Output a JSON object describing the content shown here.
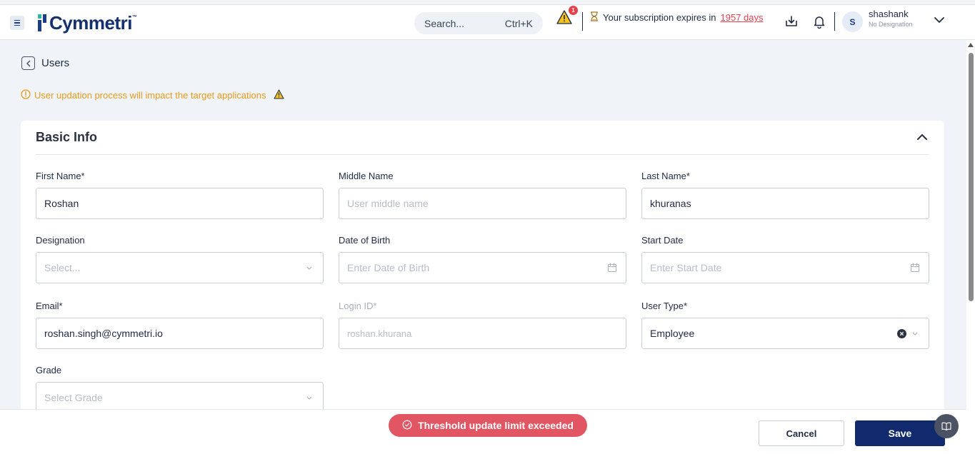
{
  "header": {
    "logo_text": "Cymmetri",
    "logo_tm": "™",
    "search": {
      "placeholder": "Search...",
      "shortcut": "Ctrl+K"
    },
    "alerts_count": "1",
    "subscription": {
      "prefix": "Your subscription expires in",
      "days": "1957 days"
    },
    "user": {
      "initial": "S",
      "name": "shashank",
      "designation": "No Designation"
    }
  },
  "breadcrumb": {
    "back_label": "Users"
  },
  "notice": {
    "text": "User updation process will impact the target applications"
  },
  "section": {
    "title": "Basic Info"
  },
  "form": {
    "first_name": {
      "label": "First Name*",
      "value": "Roshan"
    },
    "middle_name": {
      "label": "Middle Name",
      "placeholder": "User middle name"
    },
    "last_name": {
      "label": "Last Name*",
      "value": "khuranas"
    },
    "designation": {
      "label": "Designation",
      "placeholder": "Select..."
    },
    "dob": {
      "label": "Date of Birth",
      "placeholder": "Enter Date of Birth"
    },
    "start_date": {
      "label": "Start Date",
      "placeholder": "Enter Start Date"
    },
    "email": {
      "label": "Email*",
      "value": "roshan.singh@cymmetri.io"
    },
    "login_id": {
      "label": "Login ID*",
      "value": "roshan.khurana"
    },
    "user_type": {
      "label": "User Type*",
      "value": "Employee"
    },
    "grade": {
      "label": "Grade",
      "placeholder": "Select Grade"
    }
  },
  "toast": {
    "text": "Threshold update limit exceeded"
  },
  "actions": {
    "cancel": "Cancel",
    "save": "Save"
  },
  "colors": {
    "primary": "#112a6e",
    "danger": "#e25664",
    "warning": "#e89a1a",
    "brand_teal": "#2db6a4"
  }
}
